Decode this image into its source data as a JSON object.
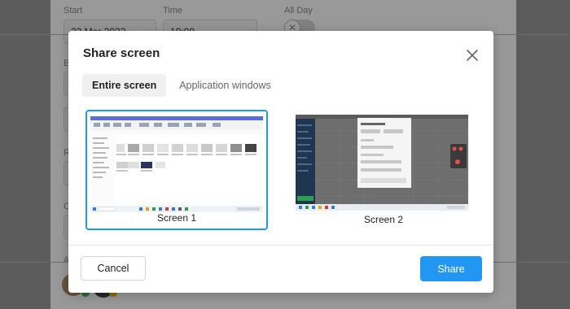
{
  "background": {
    "start_label": "Start",
    "time_label": "Time",
    "all_day_label": "All Day",
    "start_value": "23 Mar 2022",
    "time_value": "10:00",
    "toggle_icon": "x-icon"
  },
  "modal": {
    "title": "Share screen",
    "tabs": [
      {
        "label": "Entire screen",
        "active": true
      },
      {
        "label": "Application windows",
        "active": false
      }
    ],
    "screens": [
      {
        "label": "Screen 1",
        "selected": true
      },
      {
        "label": "Screen 2",
        "selected": false
      }
    ],
    "cancel_label": "Cancel",
    "share_label": "Share"
  },
  "colors": {
    "accent": "#2196f3",
    "dark_sidebar": "#1f3550",
    "overlay": "rgba(0,0,0,0.40)"
  }
}
